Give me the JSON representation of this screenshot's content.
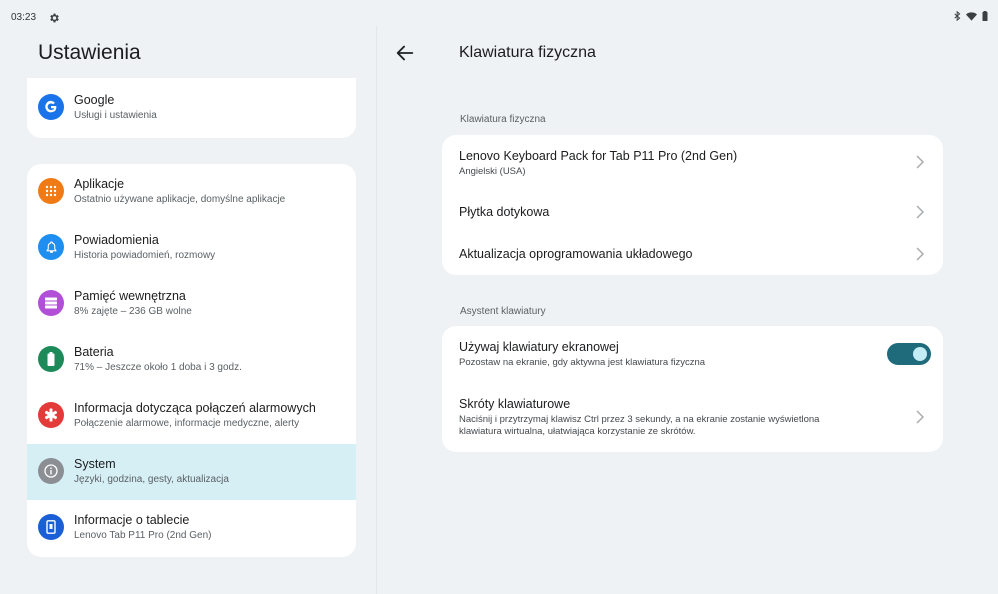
{
  "status_bar": {
    "time": "03:23",
    "icons": [
      "gear-icon",
      "bluetooth-icon",
      "wifi-icon",
      "battery-icon"
    ]
  },
  "left_pane": {
    "title": "Ustawienia",
    "google": {
      "title": "Google",
      "subtitle": "Usługi i ustawienia",
      "icon": "google-icon",
      "color": "#1a73e8"
    },
    "items": [
      {
        "title": "Aplikacje",
        "subtitle": "Ostatnio używane aplikacje, domyślne aplikacje",
        "icon": "apps-grid-icon",
        "color": "#f07b16"
      },
      {
        "title": "Powiadomienia",
        "subtitle": "Historia powiadomień, rozmowy",
        "icon": "bell-icon",
        "color": "#1f8ef1"
      },
      {
        "title": "Pamięć wewnętrzna",
        "subtitle": "8% zajęte – 236 GB wolne",
        "icon": "storage-icon",
        "color": "#b14fd6"
      },
      {
        "title": "Bateria",
        "subtitle": "71% – Jeszcze około 1 doba i 3 godz.",
        "icon": "battery-icon",
        "color": "#1e8a5a"
      },
      {
        "title": "Informacja dotycząca połączeń alarmowych",
        "subtitle": "Połączenie alarmowe, informacje medyczne, alerty",
        "icon": "emergency-icon",
        "color": "#e33a3a"
      },
      {
        "title": "System",
        "subtitle": "Języki, godzina, gesty, aktualizacja",
        "icon": "info-icon",
        "color": "#8b8f93",
        "selected": true
      },
      {
        "title": "Informacje o tablecie",
        "subtitle": "Lenovo Tab P11 Pro (2nd Gen)",
        "icon": "tablet-icon",
        "color": "#1a5fd6"
      }
    ]
  },
  "right_pane": {
    "title": "Klawiatura fizyczna",
    "section1_label": "Klawiatura fizyczna",
    "section1_rows": [
      {
        "title": "Lenovo Keyboard Pack for Tab P11 Pro (2nd Gen)",
        "subtitle": "Angielski (USA)"
      },
      {
        "title": "Płytka dotykowa"
      },
      {
        "title": "Aktualizacja oprogramowania układowego"
      }
    ],
    "section2_label": "Asystent klawiatury",
    "toggle_row": {
      "title": "Używaj klawiatury ekranowej",
      "subtitle": "Pozostaw na ekranie, gdy aktywna jest klawiatura fizyczna",
      "enabled": true
    },
    "shortcuts_row": {
      "title": "Skróty klawiaturowe",
      "subtitle_line1": "Naciśnij i przytrzymaj klawisz Ctrl przez 3 sekundy, a na ekranie zostanie wyświetlona",
      "subtitle_line2": "klawiatura wirtualna, ułatwiająca korzystanie ze skrótów."
    }
  },
  "colors": {
    "background": "#eef2f4",
    "card": "#ffffff",
    "selected": "#d6eff5",
    "toggle_track": "#1f6b7c",
    "toggle_knob": "#c4ecf5"
  }
}
